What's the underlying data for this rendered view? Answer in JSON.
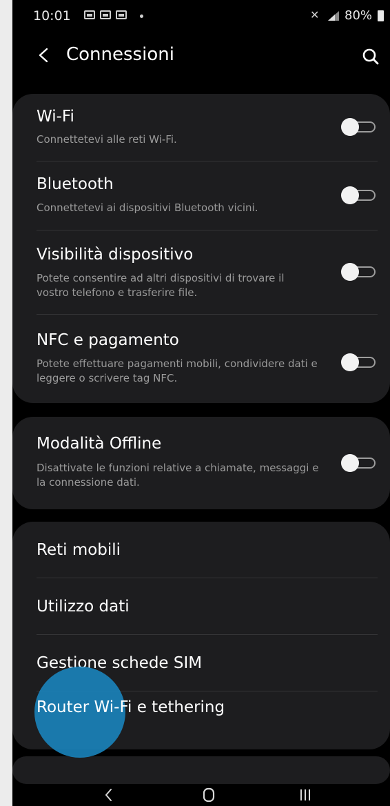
{
  "status_bar": {
    "time": "10:01",
    "battery": "80%"
  },
  "header": {
    "title": "Connessioni"
  },
  "main_settings": [
    {
      "title": "Wi-Fi",
      "subtitle": "Connettetevi alle reti Wi-Fi.",
      "enabled": false
    },
    {
      "title": "Bluetooth",
      "subtitle": "Connettetevi ai dispositivi Bluetooth vicini.",
      "enabled": false
    },
    {
      "title": "Visibilità dispositivo",
      "subtitle": "Potete consentire ad altri dispositivi di trovare il vostro telefono e trasferire file.",
      "enabled": false
    },
    {
      "title": "NFC e pagamento",
      "subtitle": "Potete effettuare pagamenti mobili, condividere dati e leggere o scrivere tag NFC.",
      "enabled": false
    }
  ],
  "offline": {
    "title": "Modalità Offline",
    "subtitle": "Disattivate le funzioni relative a chiamate, messaggi e la connessione dati.",
    "enabled": false
  },
  "network_items": [
    {
      "label": "Reti mobili"
    },
    {
      "label": "Utilizzo dati"
    },
    {
      "label": "Gestione schede SIM"
    },
    {
      "label": "Router Wi-Fi e tethering"
    }
  ],
  "colors": {
    "background": "#000000",
    "card": "#1d1d1f",
    "touch_highlight": "#1a86c0"
  },
  "icons": {
    "back": "chevron-left-icon",
    "search": "search-icon",
    "nav_back": "chevron-left-icon",
    "nav_home": "home-icon",
    "nav_recents": "recents-icon"
  }
}
